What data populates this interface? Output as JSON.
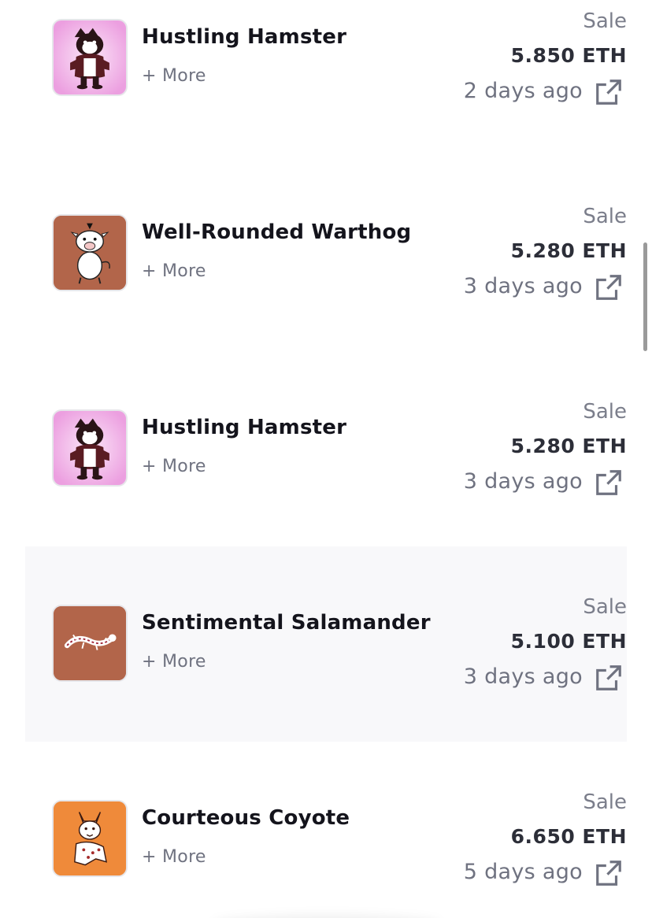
{
  "activity": [
    {
      "name": "Hustling Hamster",
      "more": "+ More",
      "type": "Sale",
      "price": "5.850 ETH",
      "time": "2 days ago",
      "thumb_bg": "#f6c6ee",
      "image": "hamster-avatar",
      "highlighted": false
    },
    {
      "name": "Well-Rounded Warthog",
      "more": "+ More",
      "type": "Sale",
      "price": "5.280 ETH",
      "time": "3 days ago",
      "thumb_bg": "#b2654a",
      "image": "warthog-avatar",
      "highlighted": false
    },
    {
      "name": "Hustling Hamster",
      "more": "+ More",
      "type": "Sale",
      "price": "5.280 ETH",
      "time": "3 days ago",
      "thumb_bg": "#f6c6ee",
      "image": "hamster-avatar",
      "highlighted": false
    },
    {
      "name": "Sentimental Salamander",
      "more": "+ More",
      "type": "Sale",
      "price": "5.100 ETH",
      "time": "3 days ago",
      "thumb_bg": "#b2654a",
      "image": "salamander-avatar",
      "highlighted": true
    },
    {
      "name": "Courteous Coyote",
      "more": "+ More",
      "type": "Sale",
      "price": "6.650 ETH",
      "time": "5 days ago",
      "thumb_bg": "#ef8a3a",
      "image": "coyote-avatar",
      "highlighted": false
    }
  ],
  "icons": {
    "external_link": "external-link-icon"
  },
  "colors": {
    "highlight_row": "#f8f8fa",
    "title": "#14141c",
    "muted": "#6f7280"
  }
}
